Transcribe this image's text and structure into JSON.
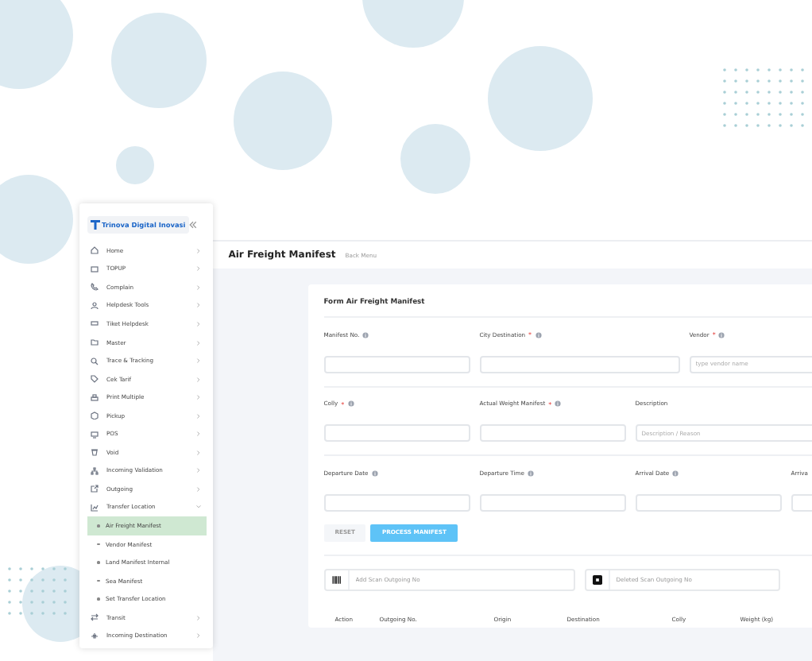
{
  "sidebar": {
    "brand": "Trinova Digital Inovasi",
    "items": [
      {
        "label": "Home",
        "expanded": false
      },
      {
        "label": "TOPUP",
        "expanded": false
      },
      {
        "label": "Complain",
        "expanded": false
      },
      {
        "label": "Helpdesk Tools",
        "expanded": false
      },
      {
        "label": "Tiket Helpdesk",
        "expanded": false
      },
      {
        "label": "Master",
        "expanded": false
      },
      {
        "label": "Trace & Tracking",
        "expanded": false
      },
      {
        "label": "Cek Tarif",
        "expanded": false
      },
      {
        "label": "Print Multiple",
        "expanded": false
      },
      {
        "label": "Pickup",
        "expanded": false
      },
      {
        "label": "POS",
        "expanded": false
      },
      {
        "label": "Void",
        "expanded": false
      },
      {
        "label": "Incoming Validation",
        "expanded": false
      },
      {
        "label": "Outgoing",
        "expanded": false
      },
      {
        "label": "Transfer Location",
        "expanded": true,
        "children": [
          {
            "label": "Air Freight Manifest",
            "selected": true
          },
          {
            "label": "Vendor Manifest",
            "selected": false
          },
          {
            "label": "Land Manifest Internal",
            "selected": false
          },
          {
            "label": "Sea Manifest",
            "selected": false
          },
          {
            "label": "Set Transfer Location",
            "selected": false
          }
        ]
      },
      {
        "label": "Transit",
        "expanded": false
      },
      {
        "label": "Incoming Destination",
        "expanded": false
      }
    ]
  },
  "page": {
    "title": "Air Freight Manifest",
    "back_link": "Back Menu"
  },
  "form": {
    "title": "Form Air Freight Manifest",
    "rows": [
      [
        {
          "label": "Manifest No.",
          "info": true
        },
        {
          "label": "City Destination",
          "required_mark": "*",
          "info": true
        },
        {
          "label": "Vendor",
          "required_mark": "*",
          "info": true,
          "placeholder": "type vendor name"
        }
      ],
      [
        {
          "label": "Colly",
          "required_mark": "*",
          "info": true
        },
        {
          "label": "Actual Weight Manifest",
          "required_mark": "*",
          "info": true
        },
        {
          "label": "Description",
          "info": false,
          "placeholder": "Description / Reason"
        }
      ],
      [
        {
          "label": "Departure Date",
          "info": true
        },
        {
          "label": "Departure Time",
          "info": true
        },
        {
          "label": "Arrival Date",
          "info": true
        },
        {
          "label": "Arriva",
          "info": false
        }
      ]
    ],
    "buttons": [
      {
        "label": "RESET",
        "kind": "secondary"
      },
      {
        "label": "PROCESS MANIFEST",
        "kind": "primary"
      }
    ],
    "scan_fields": [
      {
        "kind": "add",
        "placeholder": "Add Scan Outgoing No"
      },
      {
        "kind": "delete",
        "placeholder": "Deleted Scan Outgoing No"
      }
    ]
  },
  "table": {
    "columns": [
      "Action",
      "Outgoing No.",
      "Origin",
      "Destination",
      "Colly",
      "Weight (kg)"
    ]
  }
}
